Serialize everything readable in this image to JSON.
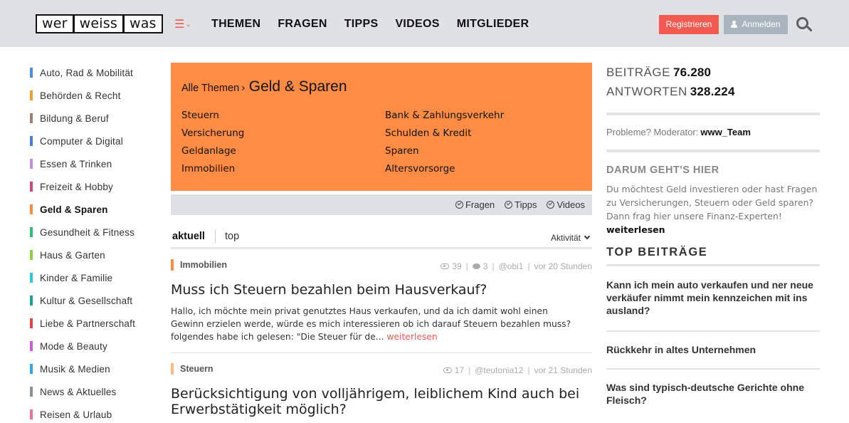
{
  "header": {
    "logo": [
      "wer",
      "weiss",
      "was"
    ],
    "nav": [
      "THEMEN",
      "FRAGEN",
      "TIPPS",
      "VIDEOS",
      "MITGLIEDER"
    ],
    "register_label": "Registrieren",
    "login_label": "Anmelden",
    "accent_color": "#f05a50"
  },
  "sidebar": {
    "items": [
      {
        "label": "Auto, Rad & Mobilität",
        "color": "#4a8fd6"
      },
      {
        "label": "Behörden & Recht",
        "color": "#f0a030"
      },
      {
        "label": "Bildung & Beruf",
        "color": "#a08070"
      },
      {
        "label": "Computer & Digital",
        "color": "#4a7fe0"
      },
      {
        "label": "Essen & Trinken",
        "color": "#c090e0"
      },
      {
        "label": "Freizeit & Hobby",
        "color": "#d04880"
      },
      {
        "label": "Geld & Sparen",
        "color": "#ff8c45",
        "active": true
      },
      {
        "label": "Gesundheit & Fitness",
        "color": "#30c070"
      },
      {
        "label": "Haus & Garten",
        "color": "#90d040"
      },
      {
        "label": "Kinder & Familie",
        "color": "#30c8d8"
      },
      {
        "label": "Kultur & Gesellschaft",
        "color": "#20a090"
      },
      {
        "label": "Liebe & Partnerschaft",
        "color": "#e04848"
      },
      {
        "label": "Mode & Beauty",
        "color": "#c860d8"
      },
      {
        "label": "Musik & Medien",
        "color": "#30a8f0"
      },
      {
        "label": "News & Aktuelles",
        "color": "#8a9098"
      },
      {
        "label": "Reisen & Urlaub",
        "color": "#f070a0"
      }
    ]
  },
  "topic": {
    "all_label": "Alle Themen",
    "separator": "›",
    "current": "Geld & Sparen",
    "color": "#ff8c45",
    "subtopics": [
      "Steuern",
      "Bank & Zahlungsverkehr",
      "Versicherung",
      "Schulden & Kredit",
      "Geldanlage",
      "Sparen",
      "Immobilien",
      "Altersvorsorge"
    ],
    "filters": [
      "Fragen",
      "Tipps",
      "Videos"
    ]
  },
  "tabs": {
    "aktuell": "aktuell",
    "top": "top",
    "sort_label": "Aktivität"
  },
  "posts": [
    {
      "category": "Immobilien",
      "category_color": "#ff8c45",
      "views": "39",
      "comments": "3",
      "author": "@obi1",
      "time": "vor 20 Stunden",
      "title": "Muss ich Steuern bezahlen beim Hausverkauf?",
      "excerpt": "Hallo, ich möchte mein privat genutztes Haus verkaufen, und da ich damit wohl einen Gewinn erzielen werde, würde es mich interessieren ob ich darauf Steuern bezahlen muss? folgendes habe ich gelesen: \"Die Steuer für de...",
      "more": "weiterlesen"
    },
    {
      "category": "Steuern",
      "category_color": "#ffb88a",
      "views": "17",
      "author": "@teutonia12",
      "time": "vor 21 Stunden",
      "title": "Berücksichtigung von volljährigem, leiblichem Kind auch bei Erwerbstätigkeit möglich?"
    }
  ],
  "right": {
    "beitraege_label": "BEITRÄGE",
    "beitraege_value": "76.280",
    "antworten_label": "ANTWORTEN",
    "antworten_value": "328.224",
    "moderator_label": "Probleme? Moderator:",
    "moderator_name": "www_Team",
    "about_title": "DARUM GEHT'S HIER",
    "about_text": "Du möchtest Geld investieren oder hast Fragen zu Versicherungen, Steuern oder Geld sparen? Dann frag hier unsere Finanz-Experten!",
    "about_more": "weiterlesen",
    "top_title": "TOP BEITRÄGE",
    "top_items": [
      "Kann ich mein auto verkaufen und ner neue verkäufer nimmt mein kennzeichen mit ins ausland?",
      "Rückkehr in altes Unternehmen",
      "Was sind typisch-deutsche Gerichte ohne Fleisch?"
    ]
  }
}
